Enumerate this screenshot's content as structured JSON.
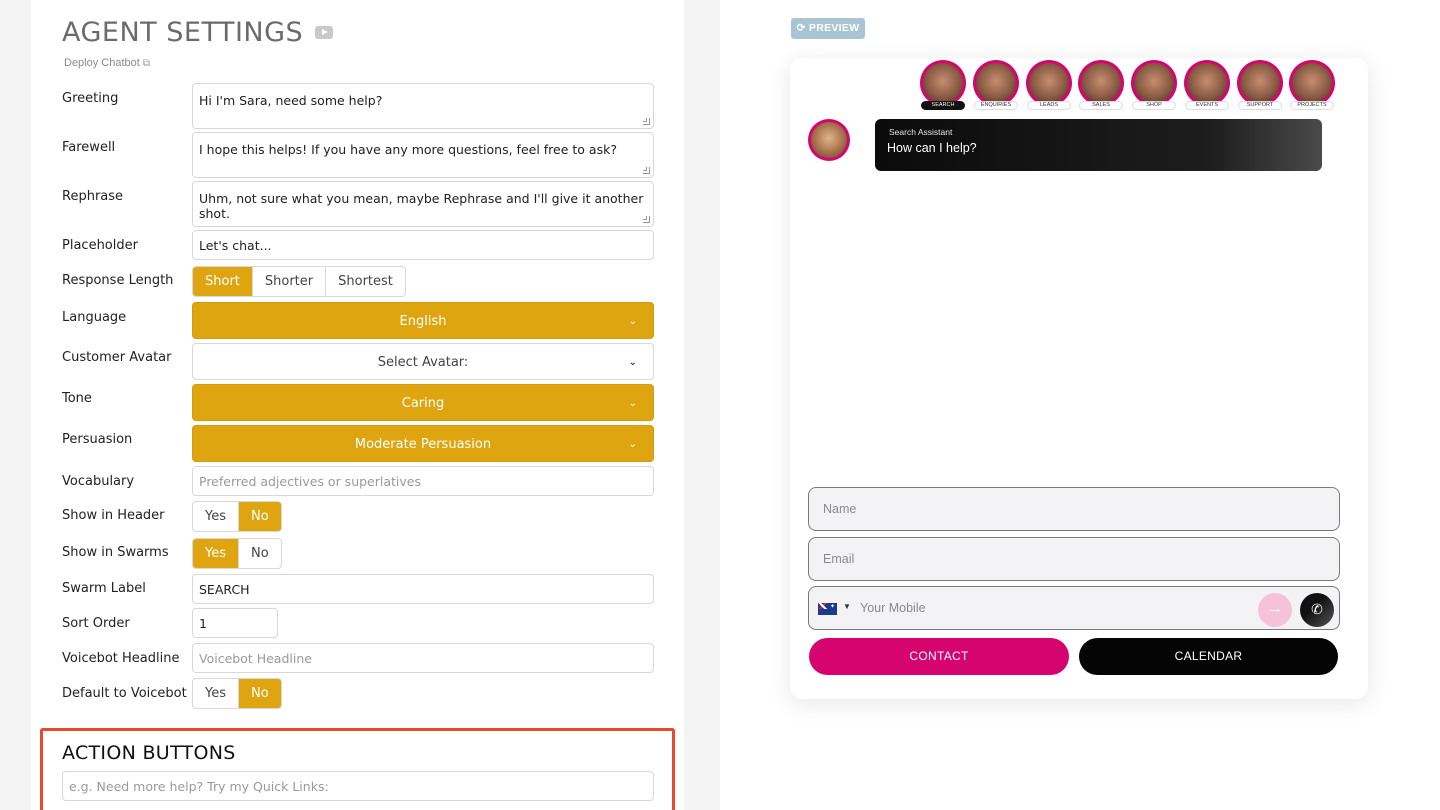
{
  "header": {
    "title": "AGENT SETTINGS",
    "deploy_link": "Deploy Chatbot",
    "external_link_glyph": "⧉"
  },
  "settings": {
    "greeting": {
      "label": "Greeting",
      "value": "Hi I'm Sara, need some help?"
    },
    "farewell": {
      "label": "Farewell",
      "value": "I hope this helps! If you have any more questions, feel free to ask?"
    },
    "rephrase": {
      "label": "Rephrase",
      "value": "Uhm, not sure what you mean, maybe Rephrase and I'll give it another shot."
    },
    "placeholder": {
      "label": "Placeholder",
      "value": "Let's chat..."
    },
    "response_length": {
      "label": "Response Length",
      "options": [
        "Short",
        "Shorter",
        "Shortest"
      ],
      "selected": "Short"
    },
    "language": {
      "label": "Language",
      "value": "English"
    },
    "customer_avatar": {
      "label": "Customer Avatar",
      "value": "Select Avatar:"
    },
    "tone": {
      "label": "Tone",
      "value": "Caring"
    },
    "persuasion": {
      "label": "Persuasion",
      "value": "Moderate Persuasion"
    },
    "vocabulary": {
      "label": "Vocabulary",
      "placeholder": "Preferred adjectives or superlatives"
    },
    "show_in_header": {
      "label": "Show in Header",
      "options": [
        "Yes",
        "No"
      ],
      "selected": "No"
    },
    "show_in_swarms": {
      "label": "Show in Swarms",
      "options": [
        "Yes",
        "No"
      ],
      "selected": "Yes"
    },
    "swarm_label": {
      "label": "Swarm Label",
      "value": "SEARCH"
    },
    "sort_order": {
      "label": "Sort Order",
      "value": "1"
    },
    "voicebot_headline": {
      "label": "Voicebot Headline",
      "placeholder": "Voicebot Headline"
    },
    "default_to_voicebot": {
      "label": "Default to Voicebot",
      "options": [
        "Yes",
        "No"
      ],
      "selected": "No"
    }
  },
  "action_buttons": {
    "title": "ACTION BUTTONS",
    "placeholder": "e.g. Need more help? Try my Quick Links:"
  },
  "preview": {
    "button_label": "PREVIEW",
    "avatars": [
      "SEARCH",
      "ENQUIRIES",
      "LEADS",
      "SALES",
      "SHOP",
      "EVENTS",
      "SUPPORT",
      "PROJECTS"
    ],
    "active_avatar": "SEARCH",
    "bubble": {
      "sender": "Search Assistant",
      "message": "How can I help?"
    },
    "form": {
      "name_placeholder": "Name",
      "email_placeholder": "Email",
      "mobile_placeholder": "Your Mobile",
      "country_flag": "flag-au-icon"
    },
    "contact_label": "CONTACT",
    "calendar_label": "CALENDAR"
  },
  "colors": {
    "accent_gold": "#dea511",
    "brand_pink": "#d6046f",
    "highlight_border": "#e84b2a",
    "preview_button": "#a9c4d4"
  }
}
